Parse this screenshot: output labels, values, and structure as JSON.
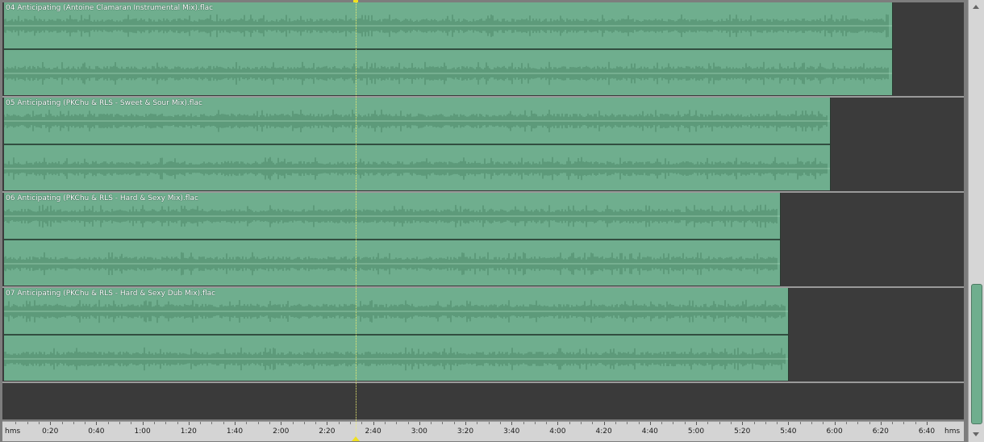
{
  "ruler": {
    "unit_left": "hms",
    "unit_right": "hms",
    "labels": [
      "0:20",
      "0:40",
      "1:00",
      "1:20",
      "1:40",
      "2:00",
      "2:20",
      "2:40",
      "3:00",
      "3:20",
      "3:40",
      "4:00",
      "4:20",
      "4:40",
      "5:00",
      "5:20",
      "5:40",
      "6:00",
      "6:20",
      "6:40"
    ]
  },
  "tracks": [
    {
      "title": "04 Anticipating (Antoine Clamaran Instrumental Mix).flac",
      "length": "6:25"
    },
    {
      "title": "05 Anticipating (PKChu & RLS - Sweet & Sour Mix).flac",
      "length": "5:58"
    },
    {
      "title": "06 Anticipating (PKChu & RLS - Hard & Sexy Mix).flac",
      "length": "5:37"
    },
    {
      "title": "07 Anticipating (PKChu & RLS - Hard & Sexy Dub Mix).flac",
      "length": "5:40"
    }
  ],
  "playhead": {
    "time": "2:33"
  },
  "colors": {
    "clip": "#6fae8e",
    "waveform": "#3f7a5a",
    "background": "#3a3a3a",
    "playhead": "#f0e020"
  }
}
